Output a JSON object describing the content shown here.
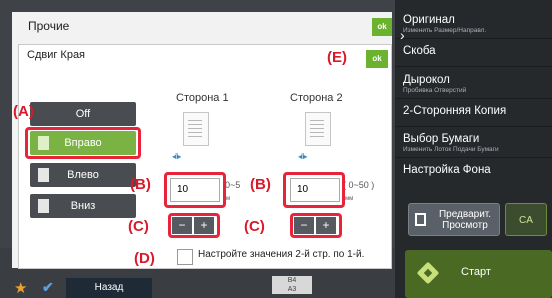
{
  "right_panel": {
    "items": [
      {
        "label": "Оригинал",
        "sub": "Изменить Размер/Направл."
      },
      {
        "label": "Скоба",
        "sub": ""
      },
      {
        "label": "Дырокол",
        "sub": "Пробивка Отверстий"
      },
      {
        "label": "2-Сторонняя Копия",
        "sub": ""
      },
      {
        "label": "Выбор Бумаги",
        "sub": "Изменить Лоток Подачи Бумаги"
      },
      {
        "label": "Настройка Фона",
        "sub": ""
      }
    ],
    "preview_label": "Предварит. Просмотр",
    "ca_label": "CA",
    "start_label": "Старт"
  },
  "outer_dialog": {
    "title": "Прочие",
    "ok_label": "ok"
  },
  "inner_dialog": {
    "title": "Сдвиг Края",
    "ok_label": "ok"
  },
  "direction": {
    "options": [
      "Off",
      "Вправо",
      "Влево",
      "Вниз"
    ],
    "selected": "Вправо"
  },
  "side1": {
    "label": "Сторона 1",
    "value": "10",
    "range": "0~5",
    "unit": "м"
  },
  "side2": {
    "label": "Сторона 2",
    "value": "10",
    "range": "( 0~50 )",
    "unit": "мм"
  },
  "stepper": {
    "minus": "−",
    "plus": "+"
  },
  "copy_checkbox_label": "Настройте значения 2-й стр. по 1-й.",
  "bottom_bar": {
    "back_label": "Назад",
    "paper_sizes": [
      "B4",
      "A3"
    ]
  },
  "callouts": {
    "A": "(A)",
    "B": "(B)",
    "C": "(C)",
    "D": "(D)",
    "E": "(E)"
  },
  "colors": {
    "accent_green": "#7ab243",
    "ok_green": "#6bb32e",
    "callout_red": "#d81a2a"
  }
}
